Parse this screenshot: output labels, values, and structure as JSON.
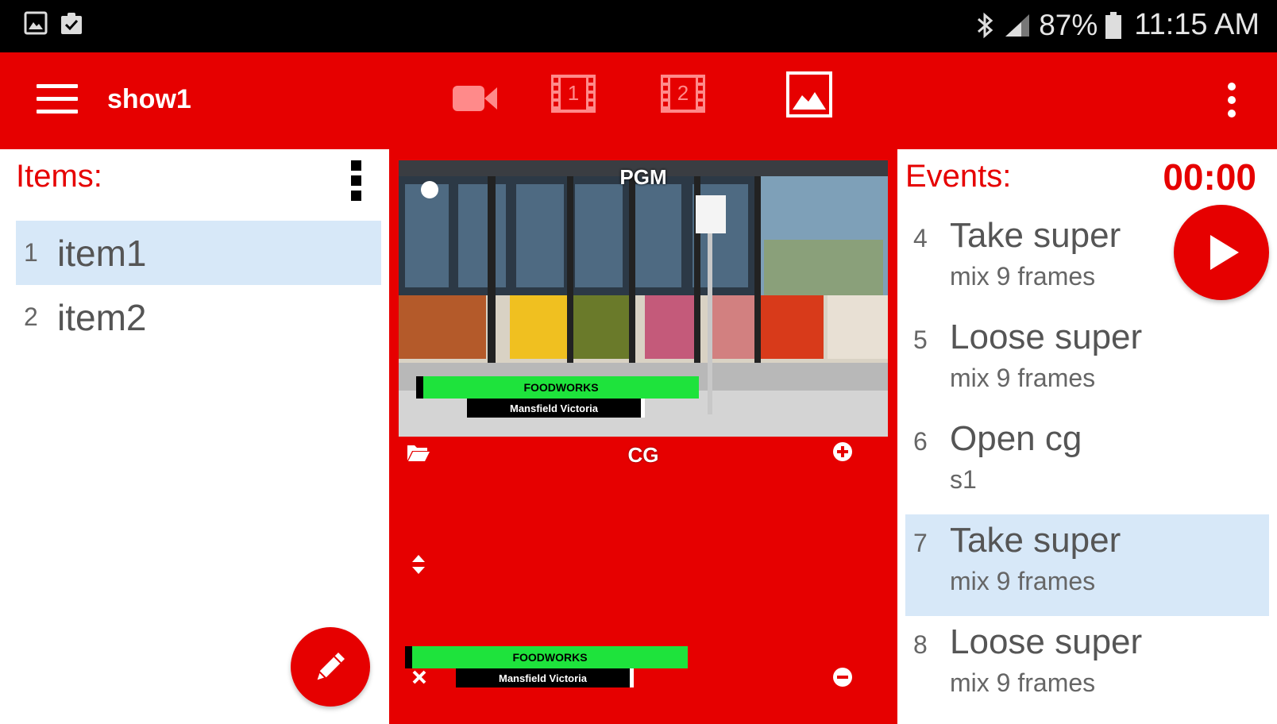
{
  "status_bar": {
    "left_icons": [
      "image-icon",
      "clipboard-check-icon"
    ],
    "right_icons": [
      "bluetooth-icon",
      "signal-icon",
      "battery-icon"
    ],
    "battery": "87%",
    "time": "11:15 AM"
  },
  "app_bar": {
    "title": "show1",
    "film1_label": "1",
    "film2_label": "2",
    "icons": [
      "menu-icon",
      "video-camera-icon",
      "film-icon",
      "film-icon",
      "image-icon",
      "overflow-menu-icon"
    ]
  },
  "items_panel": {
    "title": "Items:",
    "items": [
      {
        "num": "1",
        "label": "item1",
        "selected": true
      },
      {
        "num": "2",
        "label": "item2",
        "selected": false
      }
    ]
  },
  "preview": {
    "pgm_label": "PGM",
    "cg_label": "CG",
    "lower_third_title": "FOODWORKS",
    "lower_third_subtitle": "Mansfield Victoria",
    "lower_third_bar_color": "#1ee33c"
  },
  "events_panel": {
    "title": "Events:",
    "timer": "00:00",
    "events": [
      {
        "num": "4",
        "title": "Take super",
        "sub": "mix 9 frames",
        "selected": false
      },
      {
        "num": "5",
        "title": "Loose super",
        "sub": "mix 9 frames",
        "selected": false
      },
      {
        "num": "6",
        "title": "Open cg",
        "sub": "s1",
        "selected": false
      },
      {
        "num": "7",
        "title": "Take super",
        "sub": "mix 9 frames",
        "selected": true
      },
      {
        "num": "8",
        "title": "Loose super",
        "sub": "mix 9 frames",
        "selected": false
      }
    ]
  },
  "colors": {
    "accent": "#e60000",
    "selection": "#d7e8f8",
    "status_bar": "#000000"
  }
}
